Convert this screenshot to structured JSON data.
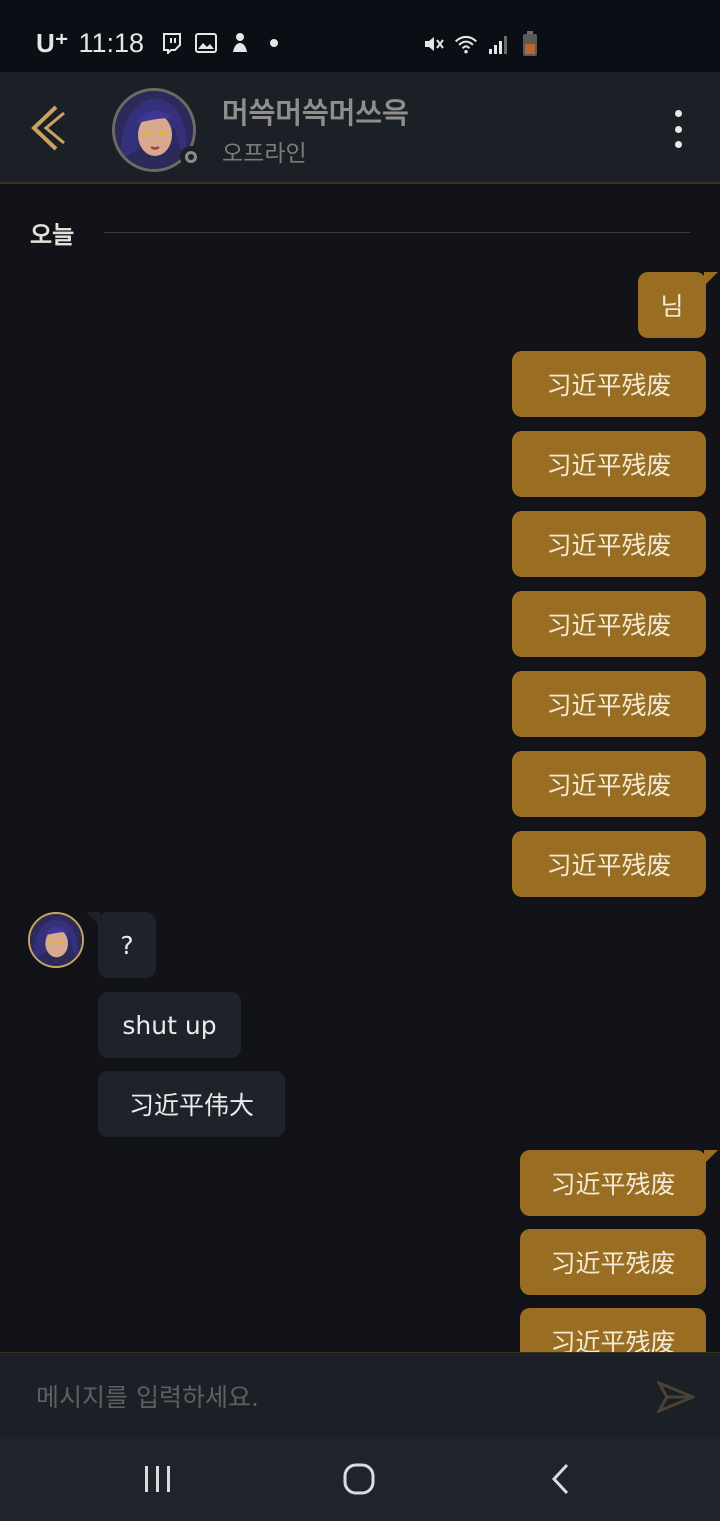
{
  "status_bar": {
    "carrier": "U⁺",
    "time": "11:18",
    "icons": [
      "twitch-icon",
      "gallery-icon",
      "notification-icon",
      "dot-icon",
      "mute-icon",
      "wifi-icon",
      "signal-icon",
      "battery-icon"
    ]
  },
  "header": {
    "name": "머쓱머쓱머쓰윽",
    "presence": "오프라인",
    "accent_color": "#c8a460"
  },
  "chat": {
    "date_label": "오늘",
    "messages": [
      {
        "dir": "out",
        "text": "님"
      },
      {
        "dir": "out",
        "text": "习近平残废"
      },
      {
        "dir": "out",
        "text": "习近平残废"
      },
      {
        "dir": "out",
        "text": "习近平残废"
      },
      {
        "dir": "out",
        "text": "习近平残废"
      },
      {
        "dir": "out",
        "text": "习近平残废"
      },
      {
        "dir": "out",
        "text": "习近平残废"
      },
      {
        "dir": "out",
        "text": "习近平残废"
      },
      {
        "dir": "in",
        "text": "?"
      },
      {
        "dir": "in",
        "text": "shut up"
      },
      {
        "dir": "in",
        "text": "习近平伟大"
      },
      {
        "dir": "out",
        "text": "习近平残废"
      },
      {
        "dir": "out",
        "text": "习近平残废"
      },
      {
        "dir": "out",
        "text": "习近平残废"
      }
    ]
  },
  "composer": {
    "placeholder": "메시지를 입력하세요.",
    "value": ""
  },
  "colors": {
    "outgoing_bubble": "#9a6e22",
    "incoming_bubble": "#1e232b",
    "background": "#111318",
    "header": "#1b1f26"
  }
}
